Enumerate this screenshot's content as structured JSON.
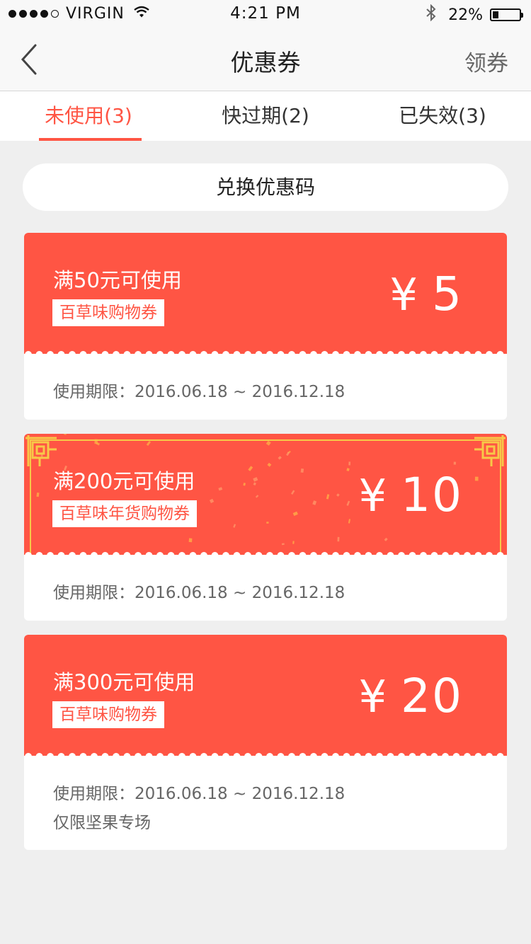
{
  "status_bar": {
    "carrier": "VIRGIN",
    "time": "4:21 PM",
    "battery_percent": "22%",
    "battery_level": 0.22,
    "signal_bars_filled": 4,
    "signal_bars_total": 5
  },
  "nav": {
    "title": "优惠券",
    "right_action": "领券"
  },
  "tabs": [
    {
      "label": "未使用(3)",
      "active": true
    },
    {
      "label": "快过期(2)",
      "active": false
    },
    {
      "label": "已失效(3)",
      "active": false
    }
  ],
  "redeem_button": "兑换优惠码",
  "coupons": [
    {
      "condition": "满50元可使用",
      "tag": "百草味购物券",
      "currency": "¥",
      "amount": "5",
      "validity": "使用期限：2016.06.18 ~ 2016.12.18",
      "note": "",
      "style": "plain"
    },
    {
      "condition": "满200元可使用",
      "tag": "百草味年货购物券",
      "currency": "¥",
      "amount": "10",
      "validity": "使用期限：2016.06.18 ~ 2016.12.18",
      "note": "",
      "style": "festive"
    },
    {
      "condition": "满300元可使用",
      "tag": "百草味购物券",
      "currency": "¥",
      "amount": "20",
      "validity": "使用期限：2016.06.18 ~ 2016.12.18",
      "note": "仅限坚果专场",
      "style": "plain"
    }
  ],
  "colors": {
    "accent": "#ff5544",
    "gold": "#f7c948",
    "background": "#efefef"
  }
}
